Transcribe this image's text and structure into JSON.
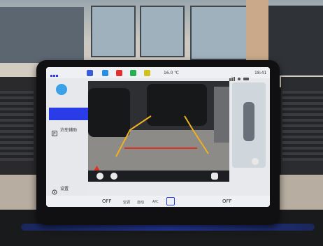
{
  "status_bar": {
    "temperature": "16.0 ℃",
    "clock": "18:41"
  },
  "sidebar": {
    "item_label": "泊车辅助",
    "settings_label": "设置"
  },
  "dock": {
    "left_temp": "OFF",
    "right_temp": "OFF",
    "climate_label": "空调",
    "auto_label": "自动",
    "ac_label": "A/C"
  },
  "colors": {
    "selection": "#2a3be8",
    "guide_yellow": "#f0b020",
    "guide_red": "#e03020",
    "ambient_blue": "#2a44c8"
  },
  "icons": {
    "app_grid": "grid-icon",
    "parking_assist": "parking-icon",
    "settings": "gear-icon",
    "warning": "warning-icon"
  }
}
